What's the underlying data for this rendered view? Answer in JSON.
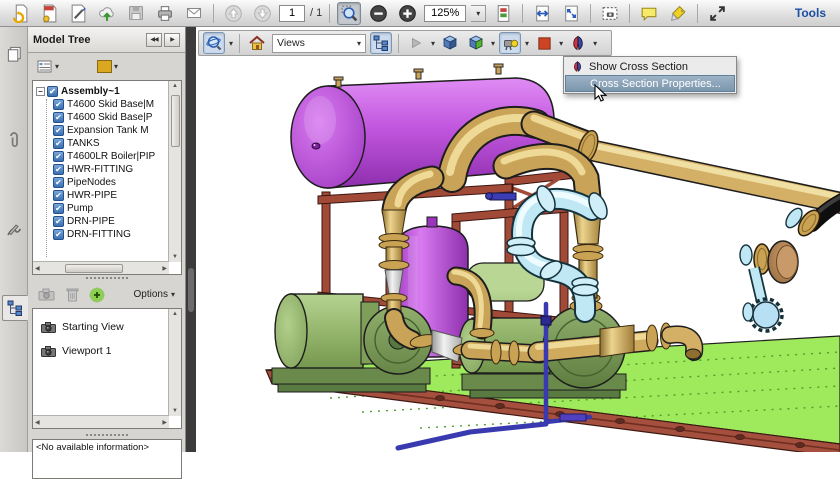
{
  "main_toolbar": {
    "page_current": "1",
    "page_total_label": "/ 1",
    "zoom_level": "125%",
    "tools_label": "Tools",
    "icon_names": [
      "convert-pdf",
      "create-pdf",
      "sign-document",
      "share-cloud",
      "save-file",
      "print",
      "email",
      "previous-page",
      "next-page",
      "marquee-zoom",
      "zoom-out",
      "zoom-in",
      "page-display",
      "fit-width",
      "fit-page",
      "snapshot",
      "comment-bubble",
      "highlight-text",
      "fullscreen"
    ]
  },
  "left_rail": {
    "icon_names": [
      "page-thumbnails",
      "attachments",
      "signatures",
      "model-tree"
    ]
  },
  "model_tree_panel": {
    "title": "Model Tree",
    "items": [
      {
        "label": "Assembly~1",
        "root": true
      },
      {
        "label": "T4600 Skid Base|M"
      },
      {
        "label": "T4600 Skid Base|P"
      },
      {
        "label": "Expansion Tank M"
      },
      {
        "label": "TANKS"
      },
      {
        "label": "T4600LR Boiler|PIP"
      },
      {
        "label": "HWR-FITTING"
      },
      {
        "label": "PipeNodes"
      },
      {
        "label": "HWR-PIPE"
      },
      {
        "label": "Pump"
      },
      {
        "label": "DRN-PIPE"
      },
      {
        "label": "DRN-FITTING"
      }
    ]
  },
  "views_panel": {
    "options_label": "Options",
    "views": [
      "Starting View",
      "Viewport 1"
    ]
  },
  "info_panel": {
    "text": "<No available information>"
  },
  "toolbar_3d": {
    "views_label": "Views"
  },
  "context_menu": {
    "items": [
      {
        "label": "Show Cross Section"
      },
      {
        "label": "Cross Section Properties..."
      }
    ]
  },
  "icons": {
    "expander_open": "−",
    "check": "✔",
    "dropdown": "▾",
    "collapse_pair": "◀◀",
    "expand_right": "▶",
    "scroll_up": "▲",
    "scroll_down": "▼",
    "scroll_left": "◀",
    "scroll_right": "▶"
  },
  "colors": {
    "tank_purple": "#c055dd",
    "pipe_gold": "#c9a458",
    "pipe_cyan": "#bfe8f4",
    "pump_green": "#9dbf77",
    "deck_green": "#9fe95c",
    "frame_red": "#a24a38",
    "drain_blue": "#3a3ab0",
    "menu_highlight": "#7b96ac",
    "tools_blue": "#1c4ea0"
  }
}
